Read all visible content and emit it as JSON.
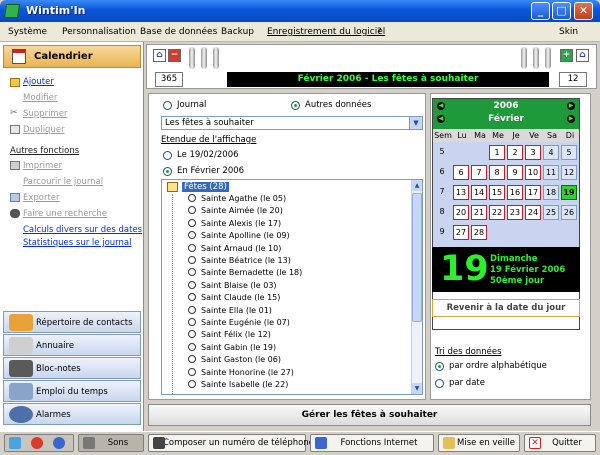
{
  "app": {
    "title": "Wintim'In",
    "skin": "Skin"
  },
  "menu": [
    "Système",
    "Personnalisation",
    "Base de données",
    "Backup",
    "Enregistrement du logiciel",
    "?"
  ],
  "sidebar": {
    "header": "Calendrier",
    "actions": [
      {
        "label": "Ajouter",
        "state": "active",
        "icon": "add-icon"
      },
      {
        "label": "Modifier",
        "state": "disabled",
        "icon": ""
      },
      {
        "label": "Supprimer",
        "state": "disabled",
        "icon": "scissors-icon"
      },
      {
        "label": "Dupliquer",
        "state": "disabled",
        "icon": "copy-icon"
      }
    ],
    "section": "Autres fonctions",
    "functions": [
      {
        "label": "Imprimer",
        "state": "disabled",
        "icon": "printer-icon"
      },
      {
        "label": "Parcourir le journal",
        "state": "disabled",
        "icon": ""
      },
      {
        "label": "Exporter",
        "state": "disabled",
        "icon": "export-icon"
      },
      {
        "label": "Faire une recherche",
        "state": "disabled",
        "icon": "binoculars-icon"
      },
      {
        "label": "Calculs divers sur des dates",
        "state": "link",
        "icon": ""
      },
      {
        "label": "Statistiques sur le journal",
        "state": "link",
        "icon": ""
      }
    ],
    "nav": [
      "Répertoire de contacts",
      "Annuaire",
      "Bloc-notes",
      "Emploi du temps",
      "Alarmes"
    ]
  },
  "top": {
    "day_count": "365",
    "days_left": "12",
    "headline": "Février 2006 - Les fêtes à souhaiter"
  },
  "view": {
    "option_journal": "Journal",
    "option_autres": "Autres données",
    "selected_option": "Autres données"
  },
  "select": {
    "value": "Les fêtes à souhaiter"
  },
  "etendue": {
    "label": "Etendue de l'affichage",
    "option_day": "Le 19/02/2006",
    "option_month": "En Février 2006",
    "selected": "month"
  },
  "tree": {
    "root": "Fêtes (28)",
    "items": [
      "Sainte Agathe (le 05)",
      "Sainte Aimée (le 20)",
      "Sainte Alexis (le 17)",
      "Sainte Apolline (le 09)",
      "Saint Arnaud (le 10)",
      "Sainte Béatrice (le 13)",
      "Sainte Bernadette (le 18)",
      "Saint Blaise (le 03)",
      "Saint Claude (le 15)",
      "Sainte Ella (le 01)",
      "Sainte Eugénie (le 07)",
      "Saint Félix (le 12)",
      "Saint Gabin (le 19)",
      "Saint Gaston (le 06)",
      "Sainte Honorine (le 27)",
      "Sainte Isabelle (le 22)"
    ]
  },
  "calendar": {
    "year": "2006",
    "month": "Février",
    "dow": [
      "Sem",
      "Lu",
      "Ma",
      "Me",
      "Je",
      "Ve",
      "Sa",
      "Di"
    ],
    "weeks": [
      {
        "wk": "5",
        "days": [
          "",
          "",
          "1",
          "2",
          "3",
          "4",
          "5"
        ]
      },
      {
        "wk": "6",
        "days": [
          "6",
          "7",
          "8",
          "9",
          "10",
          "11",
          "12"
        ]
      },
      {
        "wk": "7",
        "days": [
          "13",
          "14",
          "15",
          "16",
          "17",
          "18",
          "19"
        ]
      },
      {
        "wk": "8",
        "days": [
          "20",
          "21",
          "22",
          "23",
          "24",
          "25",
          "26"
        ]
      },
      {
        "wk": "9",
        "days": [
          "27",
          "28",
          "",
          "",
          "",
          "",
          ""
        ]
      }
    ],
    "today": "19",
    "colors": {
      "header": "#1f9a3a",
      "today": "#2bd62b",
      "accent_text": "#2df02d"
    }
  },
  "big_date": {
    "number": "19",
    "line1": "Dimanche",
    "line2": "19 Février 2006",
    "line3": "50ème jour"
  },
  "revenir": "Revenir à la date du jour",
  "tri": {
    "label": "Tri des données",
    "option_alpha": "par ordre alphabétique",
    "option_date": "par date",
    "selected": "alpha"
  },
  "gerer": "Gérer les fêtes à souhaiter",
  "bottom": {
    "sons": "Sons",
    "phone": "Composer un numéro de téléphone",
    "internet": "Fonctions Internet",
    "veille": "Mise en veille",
    "quit": "Quitter"
  }
}
